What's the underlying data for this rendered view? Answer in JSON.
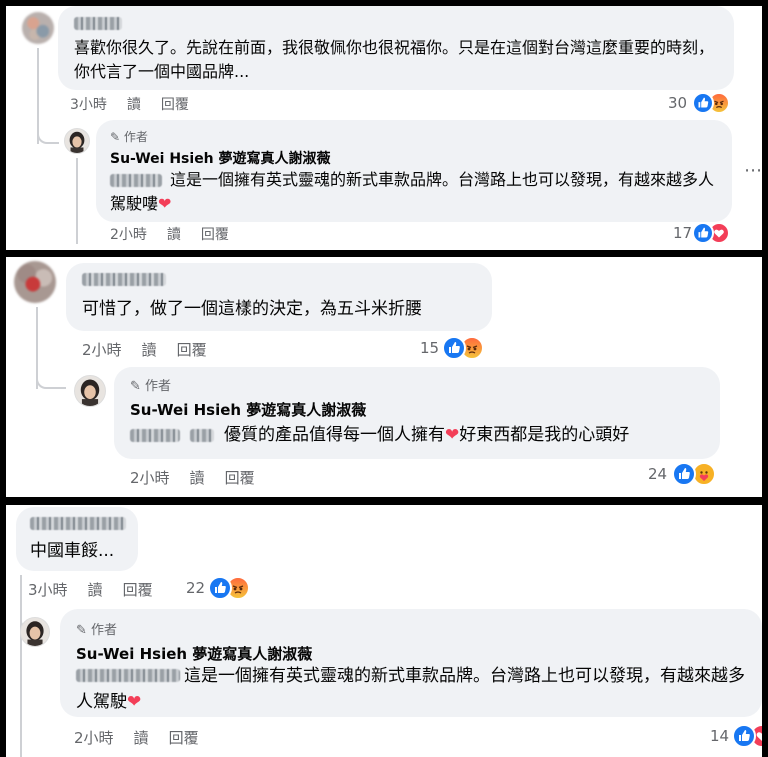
{
  "panels": [
    {
      "comment_text": "喜歡你很久了。先說在前面，我很敬佩你也很祝福你。只是在這個對台灣這麼重要的時刻，你代言了一個中國品牌...",
      "comment_time": "3小時",
      "read_label": "讀",
      "reply_label": "回覆",
      "comment_count": "30",
      "reply": {
        "author_tag": "作者",
        "author_name": "Su-Wei Hsieh 夢遊寫真人謝淑薇",
        "text": "這是一個擁有英式靈魂的新式車款品牌。台灣路上也可以發現，有越來越多人駕駛嘍",
        "time": "2小時",
        "read_label": "讀",
        "reply_label": "回覆",
        "count": "17"
      }
    },
    {
      "comment_text": "可惜了，做了一個這樣的決定，為五斗米折腰",
      "comment_time": "2小時",
      "read_label": "讀",
      "reply_label": "回覆",
      "comment_count": "15",
      "reply": {
        "author_tag": "作者",
        "author_name": "Su-Wei Hsieh 夢遊寫真人謝淑薇",
        "text_a": "優質的產品值得每一個人擁有",
        "text_b": "好東西都是我的心頭好",
        "time": "2小時",
        "read_label": "讀",
        "reply_label": "回覆",
        "count": "24"
      }
    },
    {
      "comment_text": "中國車餒...",
      "comment_time": "3小時",
      "read_label": "讀",
      "reply_label": "回覆",
      "comment_count": "22",
      "reply": {
        "author_tag": "作者",
        "author_name": "Su-Wei Hsieh 夢遊寫真人謝淑薇",
        "text": "這是一個擁有英式靈魂的新式車款品牌。台灣路上也可以發現，有越來越多人駕駛",
        "time": "2小時",
        "read_label": "讀",
        "reply_label": "回覆",
        "count": "14"
      }
    }
  ],
  "icons": {
    "like": "like-icon",
    "angry": "angry-icon",
    "love": "love-icon",
    "care": "care-icon",
    "pencil": "pencil-icon",
    "more": "more-options-icon"
  },
  "colors": {
    "bubble": "#f0f2f5",
    "like_blue": "#1877f2",
    "love_red": "#f33e58",
    "meta_gray": "#65676b"
  }
}
